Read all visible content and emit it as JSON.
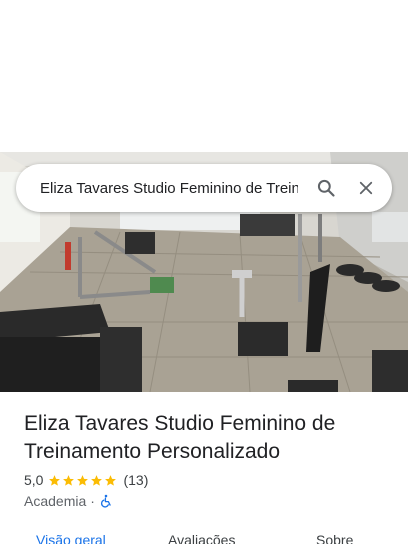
{
  "search": {
    "query": "Eliza Tavares Studio Feminino de Treinamento Personalizado"
  },
  "place": {
    "name": "Eliza Tavares Studio Feminino de Treinamento Personalizado",
    "rating": "5,0",
    "stars": 5,
    "review_count": "(13)",
    "category": "Academia",
    "separator": "·",
    "accessibility_icon": "wheelchair-icon"
  },
  "tabs": [
    {
      "label": "Visão geral",
      "active": true
    },
    {
      "label": "Avaliações",
      "active": false
    },
    {
      "label": "Sobre",
      "active": false
    }
  ],
  "colors": {
    "accent": "#1a73e8",
    "star": "#fbbc04",
    "text_primary": "#202124",
    "text_secondary": "#5f6368"
  }
}
